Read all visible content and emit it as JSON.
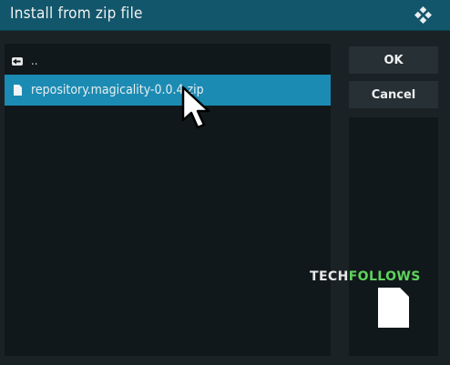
{
  "dialog": {
    "title": "Install from zip file"
  },
  "file_list": {
    "items": [
      {
        "label": "..",
        "icon": "back-folder-icon",
        "selected": false
      },
      {
        "label": "repository.magicality-0.0.4.zip",
        "icon": "file-icon",
        "selected": true
      }
    ]
  },
  "buttons": {
    "ok_label": "OK",
    "cancel_label": "Cancel"
  },
  "watermark": {
    "part_a": "TECH",
    "part_b": "FOLLOWS"
  },
  "icons": {
    "logo": "kodi-logo-icon",
    "preview": "file-icon",
    "pointer": "mouse-cursor-icon"
  },
  "colors": {
    "title_bar": "#12566b",
    "selection": "#1b8bb3",
    "background": "#1b2226",
    "list_background": "#11181b",
    "watermark_accent": "#5fd35c"
  }
}
